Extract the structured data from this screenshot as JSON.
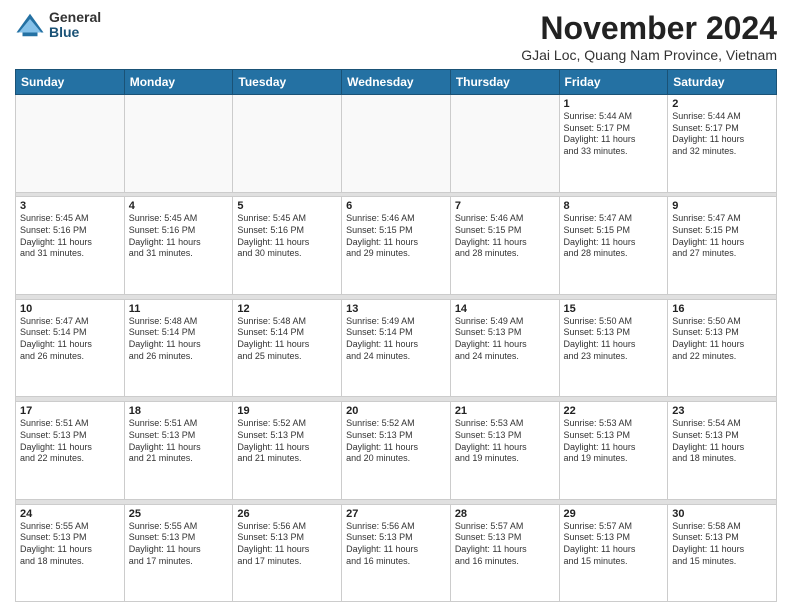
{
  "header": {
    "logo_general": "General",
    "logo_blue": "Blue",
    "title": "November 2024",
    "subtitle": "GJai Loc, Quang Nam Province, Vietnam"
  },
  "weekdays": [
    "Sunday",
    "Monday",
    "Tuesday",
    "Wednesday",
    "Thursday",
    "Friday",
    "Saturday"
  ],
  "weeks": [
    [
      {
        "day": "",
        "info": ""
      },
      {
        "day": "",
        "info": ""
      },
      {
        "day": "",
        "info": ""
      },
      {
        "day": "",
        "info": ""
      },
      {
        "day": "",
        "info": ""
      },
      {
        "day": "1",
        "info": "Sunrise: 5:44 AM\nSunset: 5:17 PM\nDaylight: 11 hours\nand 33 minutes."
      },
      {
        "day": "2",
        "info": "Sunrise: 5:44 AM\nSunset: 5:17 PM\nDaylight: 11 hours\nand 32 minutes."
      }
    ],
    [
      {
        "day": "3",
        "info": "Sunrise: 5:45 AM\nSunset: 5:16 PM\nDaylight: 11 hours\nand 31 minutes."
      },
      {
        "day": "4",
        "info": "Sunrise: 5:45 AM\nSunset: 5:16 PM\nDaylight: 11 hours\nand 31 minutes."
      },
      {
        "day": "5",
        "info": "Sunrise: 5:45 AM\nSunset: 5:16 PM\nDaylight: 11 hours\nand 30 minutes."
      },
      {
        "day": "6",
        "info": "Sunrise: 5:46 AM\nSunset: 5:15 PM\nDaylight: 11 hours\nand 29 minutes."
      },
      {
        "day": "7",
        "info": "Sunrise: 5:46 AM\nSunset: 5:15 PM\nDaylight: 11 hours\nand 28 minutes."
      },
      {
        "day": "8",
        "info": "Sunrise: 5:47 AM\nSunset: 5:15 PM\nDaylight: 11 hours\nand 28 minutes."
      },
      {
        "day": "9",
        "info": "Sunrise: 5:47 AM\nSunset: 5:15 PM\nDaylight: 11 hours\nand 27 minutes."
      }
    ],
    [
      {
        "day": "10",
        "info": "Sunrise: 5:47 AM\nSunset: 5:14 PM\nDaylight: 11 hours\nand 26 minutes."
      },
      {
        "day": "11",
        "info": "Sunrise: 5:48 AM\nSunset: 5:14 PM\nDaylight: 11 hours\nand 26 minutes."
      },
      {
        "day": "12",
        "info": "Sunrise: 5:48 AM\nSunset: 5:14 PM\nDaylight: 11 hours\nand 25 minutes."
      },
      {
        "day": "13",
        "info": "Sunrise: 5:49 AM\nSunset: 5:14 PM\nDaylight: 11 hours\nand 24 minutes."
      },
      {
        "day": "14",
        "info": "Sunrise: 5:49 AM\nSunset: 5:13 PM\nDaylight: 11 hours\nand 24 minutes."
      },
      {
        "day": "15",
        "info": "Sunrise: 5:50 AM\nSunset: 5:13 PM\nDaylight: 11 hours\nand 23 minutes."
      },
      {
        "day": "16",
        "info": "Sunrise: 5:50 AM\nSunset: 5:13 PM\nDaylight: 11 hours\nand 22 minutes."
      }
    ],
    [
      {
        "day": "17",
        "info": "Sunrise: 5:51 AM\nSunset: 5:13 PM\nDaylight: 11 hours\nand 22 minutes."
      },
      {
        "day": "18",
        "info": "Sunrise: 5:51 AM\nSunset: 5:13 PM\nDaylight: 11 hours\nand 21 minutes."
      },
      {
        "day": "19",
        "info": "Sunrise: 5:52 AM\nSunset: 5:13 PM\nDaylight: 11 hours\nand 21 minutes."
      },
      {
        "day": "20",
        "info": "Sunrise: 5:52 AM\nSunset: 5:13 PM\nDaylight: 11 hours\nand 20 minutes."
      },
      {
        "day": "21",
        "info": "Sunrise: 5:53 AM\nSunset: 5:13 PM\nDaylight: 11 hours\nand 19 minutes."
      },
      {
        "day": "22",
        "info": "Sunrise: 5:53 AM\nSunset: 5:13 PM\nDaylight: 11 hours\nand 19 minutes."
      },
      {
        "day": "23",
        "info": "Sunrise: 5:54 AM\nSunset: 5:13 PM\nDaylight: 11 hours\nand 18 minutes."
      }
    ],
    [
      {
        "day": "24",
        "info": "Sunrise: 5:55 AM\nSunset: 5:13 PM\nDaylight: 11 hours\nand 18 minutes."
      },
      {
        "day": "25",
        "info": "Sunrise: 5:55 AM\nSunset: 5:13 PM\nDaylight: 11 hours\nand 17 minutes."
      },
      {
        "day": "26",
        "info": "Sunrise: 5:56 AM\nSunset: 5:13 PM\nDaylight: 11 hours\nand 17 minutes."
      },
      {
        "day": "27",
        "info": "Sunrise: 5:56 AM\nSunset: 5:13 PM\nDaylight: 11 hours\nand 16 minutes."
      },
      {
        "day": "28",
        "info": "Sunrise: 5:57 AM\nSunset: 5:13 PM\nDaylight: 11 hours\nand 16 minutes."
      },
      {
        "day": "29",
        "info": "Sunrise: 5:57 AM\nSunset: 5:13 PM\nDaylight: 11 hours\nand 15 minutes."
      },
      {
        "day": "30",
        "info": "Sunrise: 5:58 AM\nSunset: 5:13 PM\nDaylight: 11 hours\nand 15 minutes."
      }
    ]
  ]
}
